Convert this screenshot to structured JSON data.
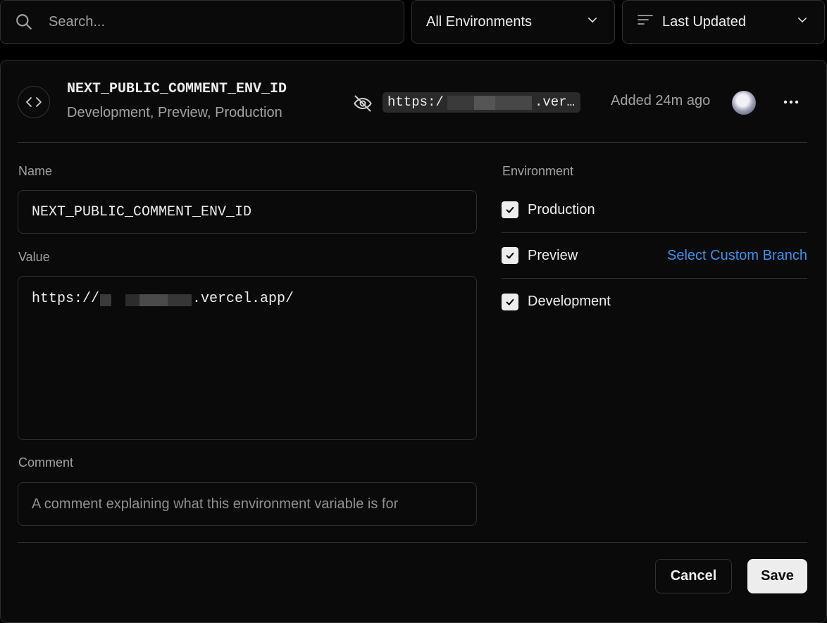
{
  "filters": {
    "search_placeholder": "Search...",
    "environment_select": "All Environments",
    "sort_select": "Last Updated"
  },
  "variable": {
    "name": "NEXT_PUBLIC_COMMENT_ENV_ID",
    "environments_summary": "Development, Preview, Production",
    "masked_value_prefix": "https:/",
    "masked_value_suffix": ".ver…",
    "added": "Added 24m ago"
  },
  "form": {
    "name_label": "Name",
    "name_value": "NEXT_PUBLIC_COMMENT_ENV_ID",
    "value_label": "Value",
    "value_prefix": "https://",
    "value_suffix": ".vercel.app/",
    "comment_label": "Comment",
    "comment_placeholder": "A comment explaining what this environment variable is for",
    "environment_label": "Environment",
    "environments": [
      {
        "label": "Production",
        "checked": true
      },
      {
        "label": "Preview",
        "checked": true
      },
      {
        "label": "Development",
        "checked": true
      }
    ],
    "custom_branch_link": "Select Custom Branch",
    "cancel_label": "Cancel",
    "save_label": "Save"
  },
  "icons": {
    "search": "search-icon",
    "chevron": "chevron-down-icon",
    "sort": "sort-lines-icon",
    "variable": "code-brackets-icon",
    "hidden": "eye-off-icon",
    "more": "more-horizontal-icon",
    "check": "check-icon"
  },
  "colors": {
    "background": "#000000",
    "surface": "#0a0a0a",
    "border": "#2e2e2e",
    "text": "#ededed",
    "muted": "#a1a1a1",
    "link": "#3c91ec"
  }
}
